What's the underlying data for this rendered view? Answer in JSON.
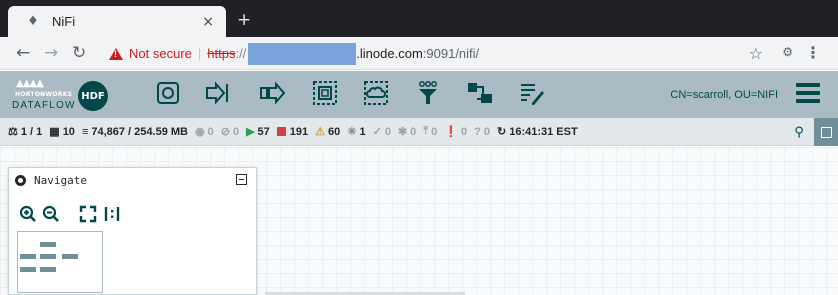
{
  "browser": {
    "tab_title": "NiFi",
    "favicon": "nifi-drop-icon",
    "new_tab_label": "+",
    "close_tab_label": "×",
    "security_label": "Not secure",
    "url_scheme": "https",
    "url_slashes": "://",
    "url_host_visible": ".linode.com",
    "url_port_path": ":9091/nifi/",
    "redaction_color": "#7aa3dc"
  },
  "header": {
    "brand_line": "HORTONWORKS",
    "product_line": "DATAFLOW",
    "badge_label": "HDF",
    "toolbar_icons": [
      "processor-icon",
      "input-port-icon",
      "output-port-icon",
      "process-group-icon",
      "remote-process-group-icon",
      "funnel-icon",
      "template-icon",
      "label-icon"
    ],
    "user_identity": "CN=scarroll, OU=NIFI",
    "background_color": "#aabbc3",
    "accent_color": "#004849"
  },
  "status": {
    "cluster": "1 / 1",
    "threads": "10",
    "queued": "74,867 / 254.59 MB",
    "transmitting": "0",
    "not_transmitting": "0",
    "running": "57",
    "stopped": "191",
    "invalid": "60",
    "disabled": "1",
    "up_to_date": "0",
    "locally_modified": "0",
    "stale": "0",
    "locally_modified_stale": "0",
    "sync_failure": "0",
    "last_refreshed": "16:41:31 EST"
  },
  "navigate": {
    "title": "Navigate",
    "zoom_in_icon": "zoom-in-icon",
    "zoom_out_icon": "zoom-out-icon",
    "fit_icon": "fit-screen-icon",
    "actual_size_icon": "actual-size-icon"
  }
}
